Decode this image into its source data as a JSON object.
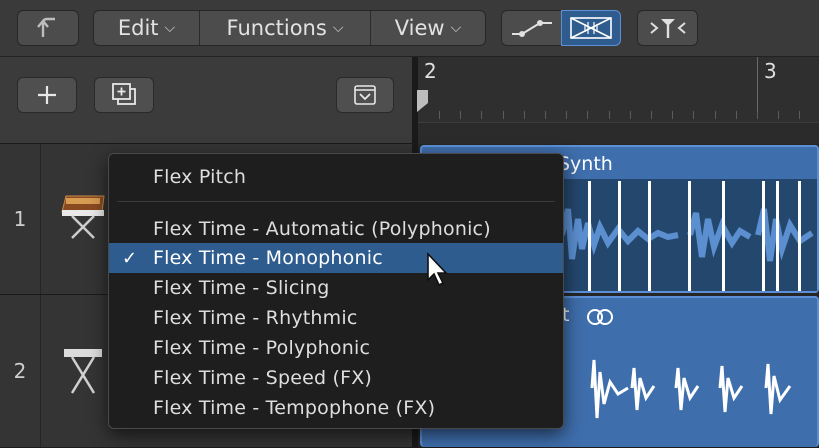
{
  "toolbar": {
    "back_icon": "curved-up-arrow-icon",
    "menus": [
      {
        "label": "Edit"
      },
      {
        "label": "Functions"
      },
      {
        "label": "View"
      }
    ],
    "automation_icon": "automation-curve-icon",
    "flex_icon": "flex-bowtie-icon",
    "catch_icon": "catch-playhead-icon"
  },
  "track_header": {
    "add_icon": "plus-icon",
    "duplicate_icon": "duplicate-track-icon",
    "collapse_icon": "collapse-chevron-icon"
  },
  "tracks": [
    {
      "number": "1",
      "icon": "synth-keyboard-icon"
    },
    {
      "number": "2",
      "icon": "keyboard-stand-icon"
    }
  ],
  "ruler": {
    "bars": [
      "2",
      "3"
    ]
  },
  "regions": [
    {
      "name": "Synth"
    },
    {
      "name": "t"
    }
  ],
  "popup_menu": {
    "items": [
      {
        "label": "Flex Pitch",
        "checked": false
      },
      {
        "label": "Flex Time - Automatic (Polyphonic)",
        "checked": false
      },
      {
        "label": "Flex Time - Monophonic",
        "checked": true
      },
      {
        "label": "Flex Time - Slicing",
        "checked": false
      },
      {
        "label": "Flex Time - Rhythmic",
        "checked": false
      },
      {
        "label": "Flex Time - Polyphonic",
        "checked": false
      },
      {
        "label": "Flex Time - Speed (FX)",
        "checked": false
      },
      {
        "label": "Flex Time - Tempophone (FX)",
        "checked": false
      }
    ],
    "check_glyph": "✓"
  },
  "colors": {
    "region": "#3f6eac",
    "selection": "#2f5c8f",
    "flex_active": "#2f5c8f"
  }
}
